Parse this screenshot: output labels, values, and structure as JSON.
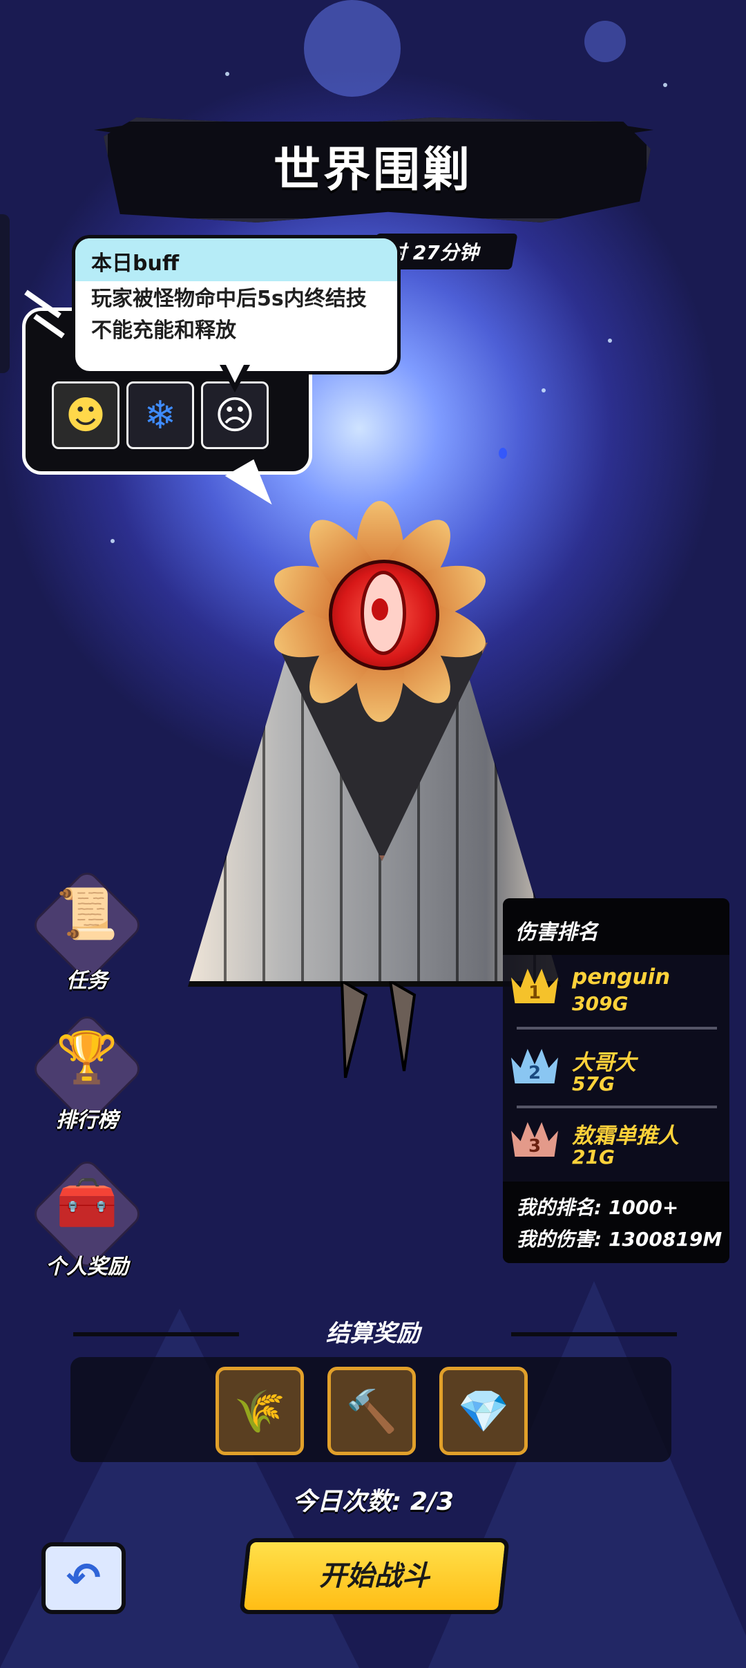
{
  "title": "世界围剿",
  "timer_text": "时 27分钟",
  "buff": {
    "heading": "本日buff",
    "line1": "玩家被怪物命中后5s内终结技",
    "line2": "不能充能和释放",
    "icons": [
      "glowing-figure-icon",
      "snowflake-down-icon",
      "dizzy-creature-icon"
    ]
  },
  "menu": {
    "task_label": "任务",
    "leaderboard_label": "排行榜",
    "personal_reward_label": "个人奖励"
  },
  "ranking": {
    "title": "伤害排名",
    "entries": [
      {
        "rank": "1",
        "name": "penguin",
        "score": "309G",
        "crown_color": "#f5c22b"
      },
      {
        "rank": "2",
        "name": "大哥大",
        "score": "57G",
        "crown_color": "#8ac6f2"
      },
      {
        "rank": "3",
        "name": "敖霜单推人",
        "score": "21G",
        "crown_color": "#e39a8a"
      }
    ],
    "my_rank": "我的排名: 1000+",
    "my_damage": "我的伤害: 1300819M"
  },
  "settlement": {
    "title": "结算奖励",
    "rewards": [
      "golden-feather-icon",
      "hammer-icon",
      "green-gems-icon"
    ]
  },
  "today_count": "今日次数: 2/3",
  "start_button": "开始战斗",
  "colors": {
    "accent_yellow": "#ffd23a",
    "bubble_header": "#b6ecf7",
    "reward_border": "#e1a02a"
  }
}
